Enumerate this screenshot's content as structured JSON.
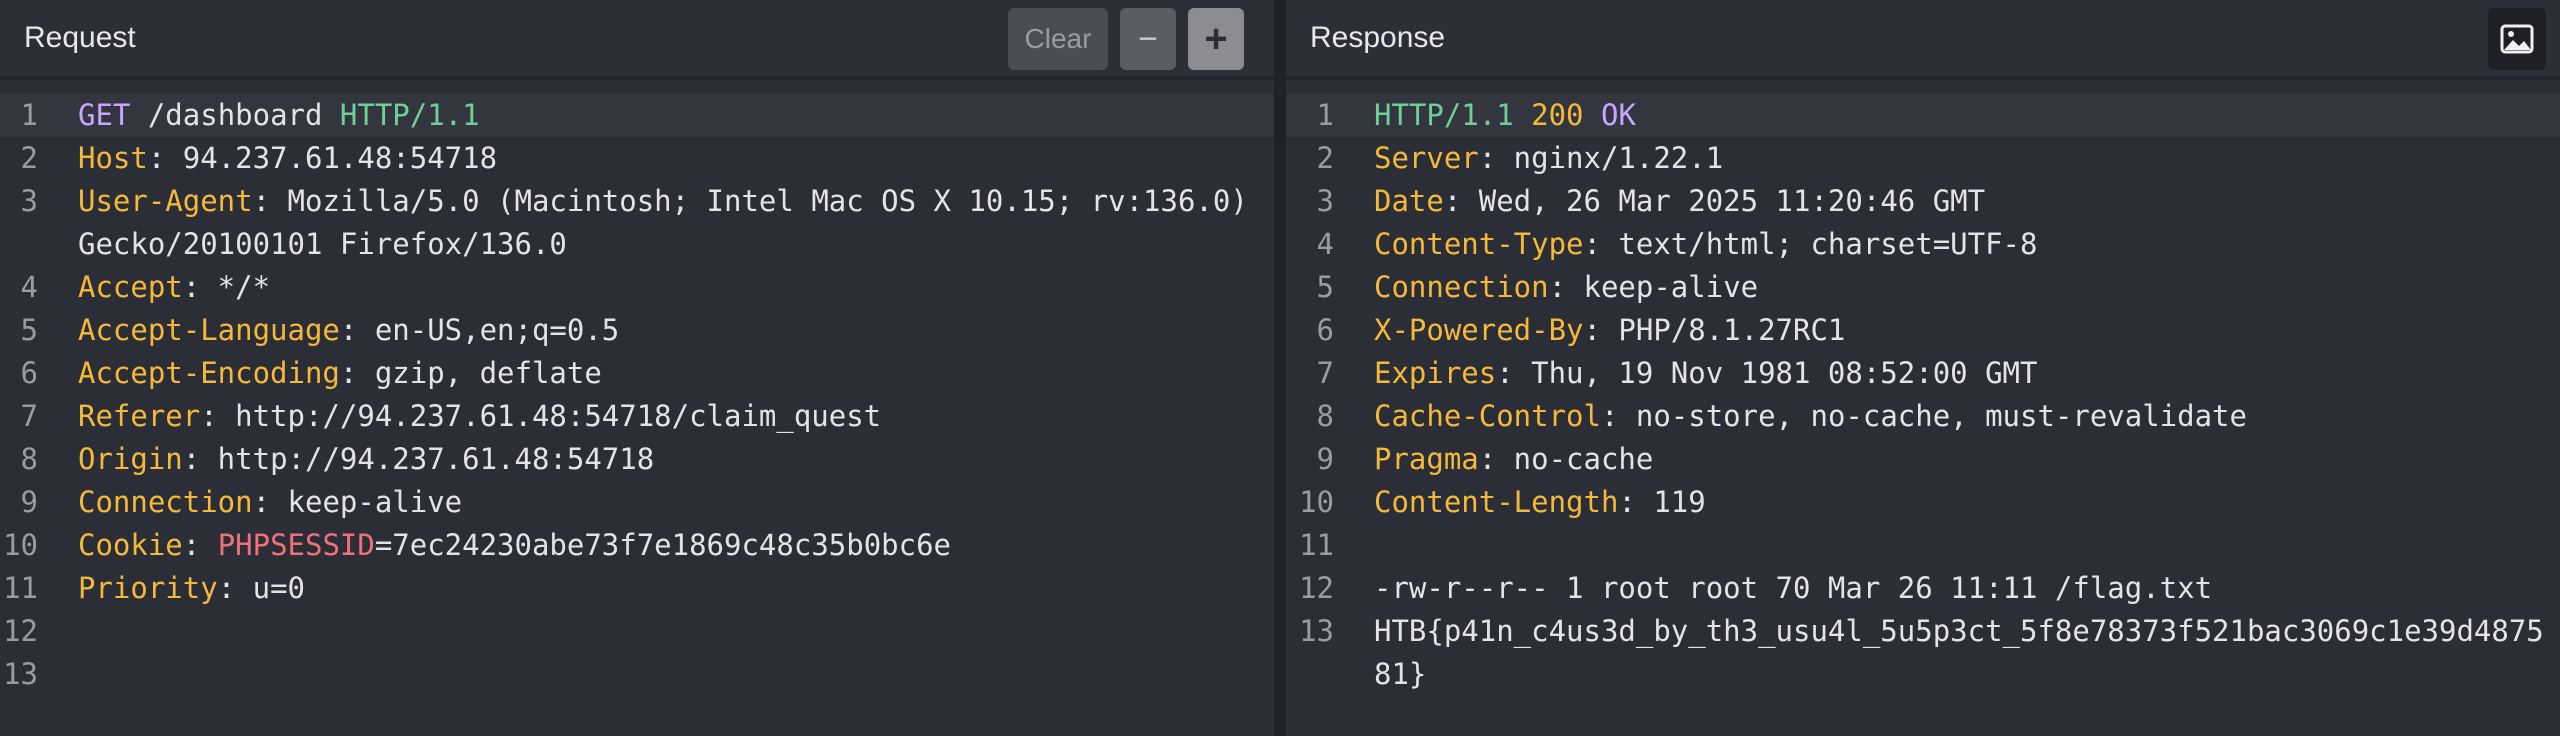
{
  "request": {
    "title": "Request",
    "buttons": {
      "clear": "Clear",
      "minus": "−",
      "plus": "+"
    },
    "lines": {
      "l1": {
        "num": "1",
        "method": "GET",
        "path": " /dashboard ",
        "proto": "HTTP/1.1"
      },
      "l2": {
        "num": "2",
        "name": "Host",
        "value": ": 94.237.61.48:54718"
      },
      "l3": {
        "num": "3",
        "name": "User-Agent",
        "value": ": Mozilla/5.0 (Macintosh; Intel Mac OS X 10.15; rv:136.0) Gecko/20100101 Firefox/136.0"
      },
      "l4": {
        "num": "4",
        "name": "Accept",
        "value": ": */*"
      },
      "l5": {
        "num": "5",
        "name": "Accept-Language",
        "value": ": en-US,en;q=0.5"
      },
      "l6": {
        "num": "6",
        "name": "Accept-Encoding",
        "value": ": gzip, deflate"
      },
      "l7": {
        "num": "7",
        "name": "Referer",
        "value": ": http://94.237.61.48:54718/claim_quest"
      },
      "l8": {
        "num": "8",
        "name": "Origin",
        "value": ": http://94.237.61.48:54718"
      },
      "l9": {
        "num": "9",
        "name": "Connection",
        "value": ": keep-alive"
      },
      "l10": {
        "num": "10",
        "name": "Cookie",
        "cookie_name": "PHPSESSID",
        "value": "=7ec24230abe73f7e1869c48c35b0bc6e"
      },
      "l11": {
        "num": "11",
        "name": "Priority",
        "value": ": u=0"
      },
      "l12": {
        "num": "12"
      },
      "l13": {
        "num": "13"
      }
    }
  },
  "response": {
    "title": "Response",
    "image_icon": "image-icon",
    "lines": {
      "l1": {
        "num": "1",
        "proto": "HTTP/1.1",
        "code": " 200 ",
        "reason": "OK"
      },
      "l2": {
        "num": "2",
        "name": "Server",
        "value": ": nginx/1.22.1"
      },
      "l3": {
        "num": "3",
        "name": "Date",
        "value": ": Wed, 26 Mar 2025 11:20:46 GMT"
      },
      "l4": {
        "num": "4",
        "name": "Content-Type",
        "value": ": text/html; charset=UTF-8"
      },
      "l5": {
        "num": "5",
        "name": "Connection",
        "value": ": keep-alive"
      },
      "l6": {
        "num": "6",
        "name": "X-Powered-By",
        "value": ": PHP/8.1.27RC1"
      },
      "l7": {
        "num": "7",
        "name": "Expires",
        "value": ": Thu, 19 Nov 1981 08:52:00 GMT"
      },
      "l8": {
        "num": "8",
        "name": "Cache-Control",
        "value": ": no-store, no-cache, must-revalidate"
      },
      "l9": {
        "num": "9",
        "name": "Pragma",
        "value": ": no-cache"
      },
      "l10": {
        "num": "10",
        "name": "Content-Length",
        "value": ": 119"
      },
      "l11": {
        "num": "11"
      },
      "l12": {
        "num": "12",
        "text": "-rw-r--r-- 1 root root 70 Mar 26 11:11 /flag.txt"
      },
      "l13": {
        "num": "13",
        "text": "HTB{p41n_c4us3d_by_th3_usu4l_5u5p3ct_5f8e78373f521bac3069c1e39d487581}"
      }
    }
  },
  "colors": {
    "background": "#2b2e36",
    "method": "#c8a6ff",
    "protocol": "#6fcf97",
    "header_name": "#f5b93a",
    "cookie_name": "#f07178"
  }
}
